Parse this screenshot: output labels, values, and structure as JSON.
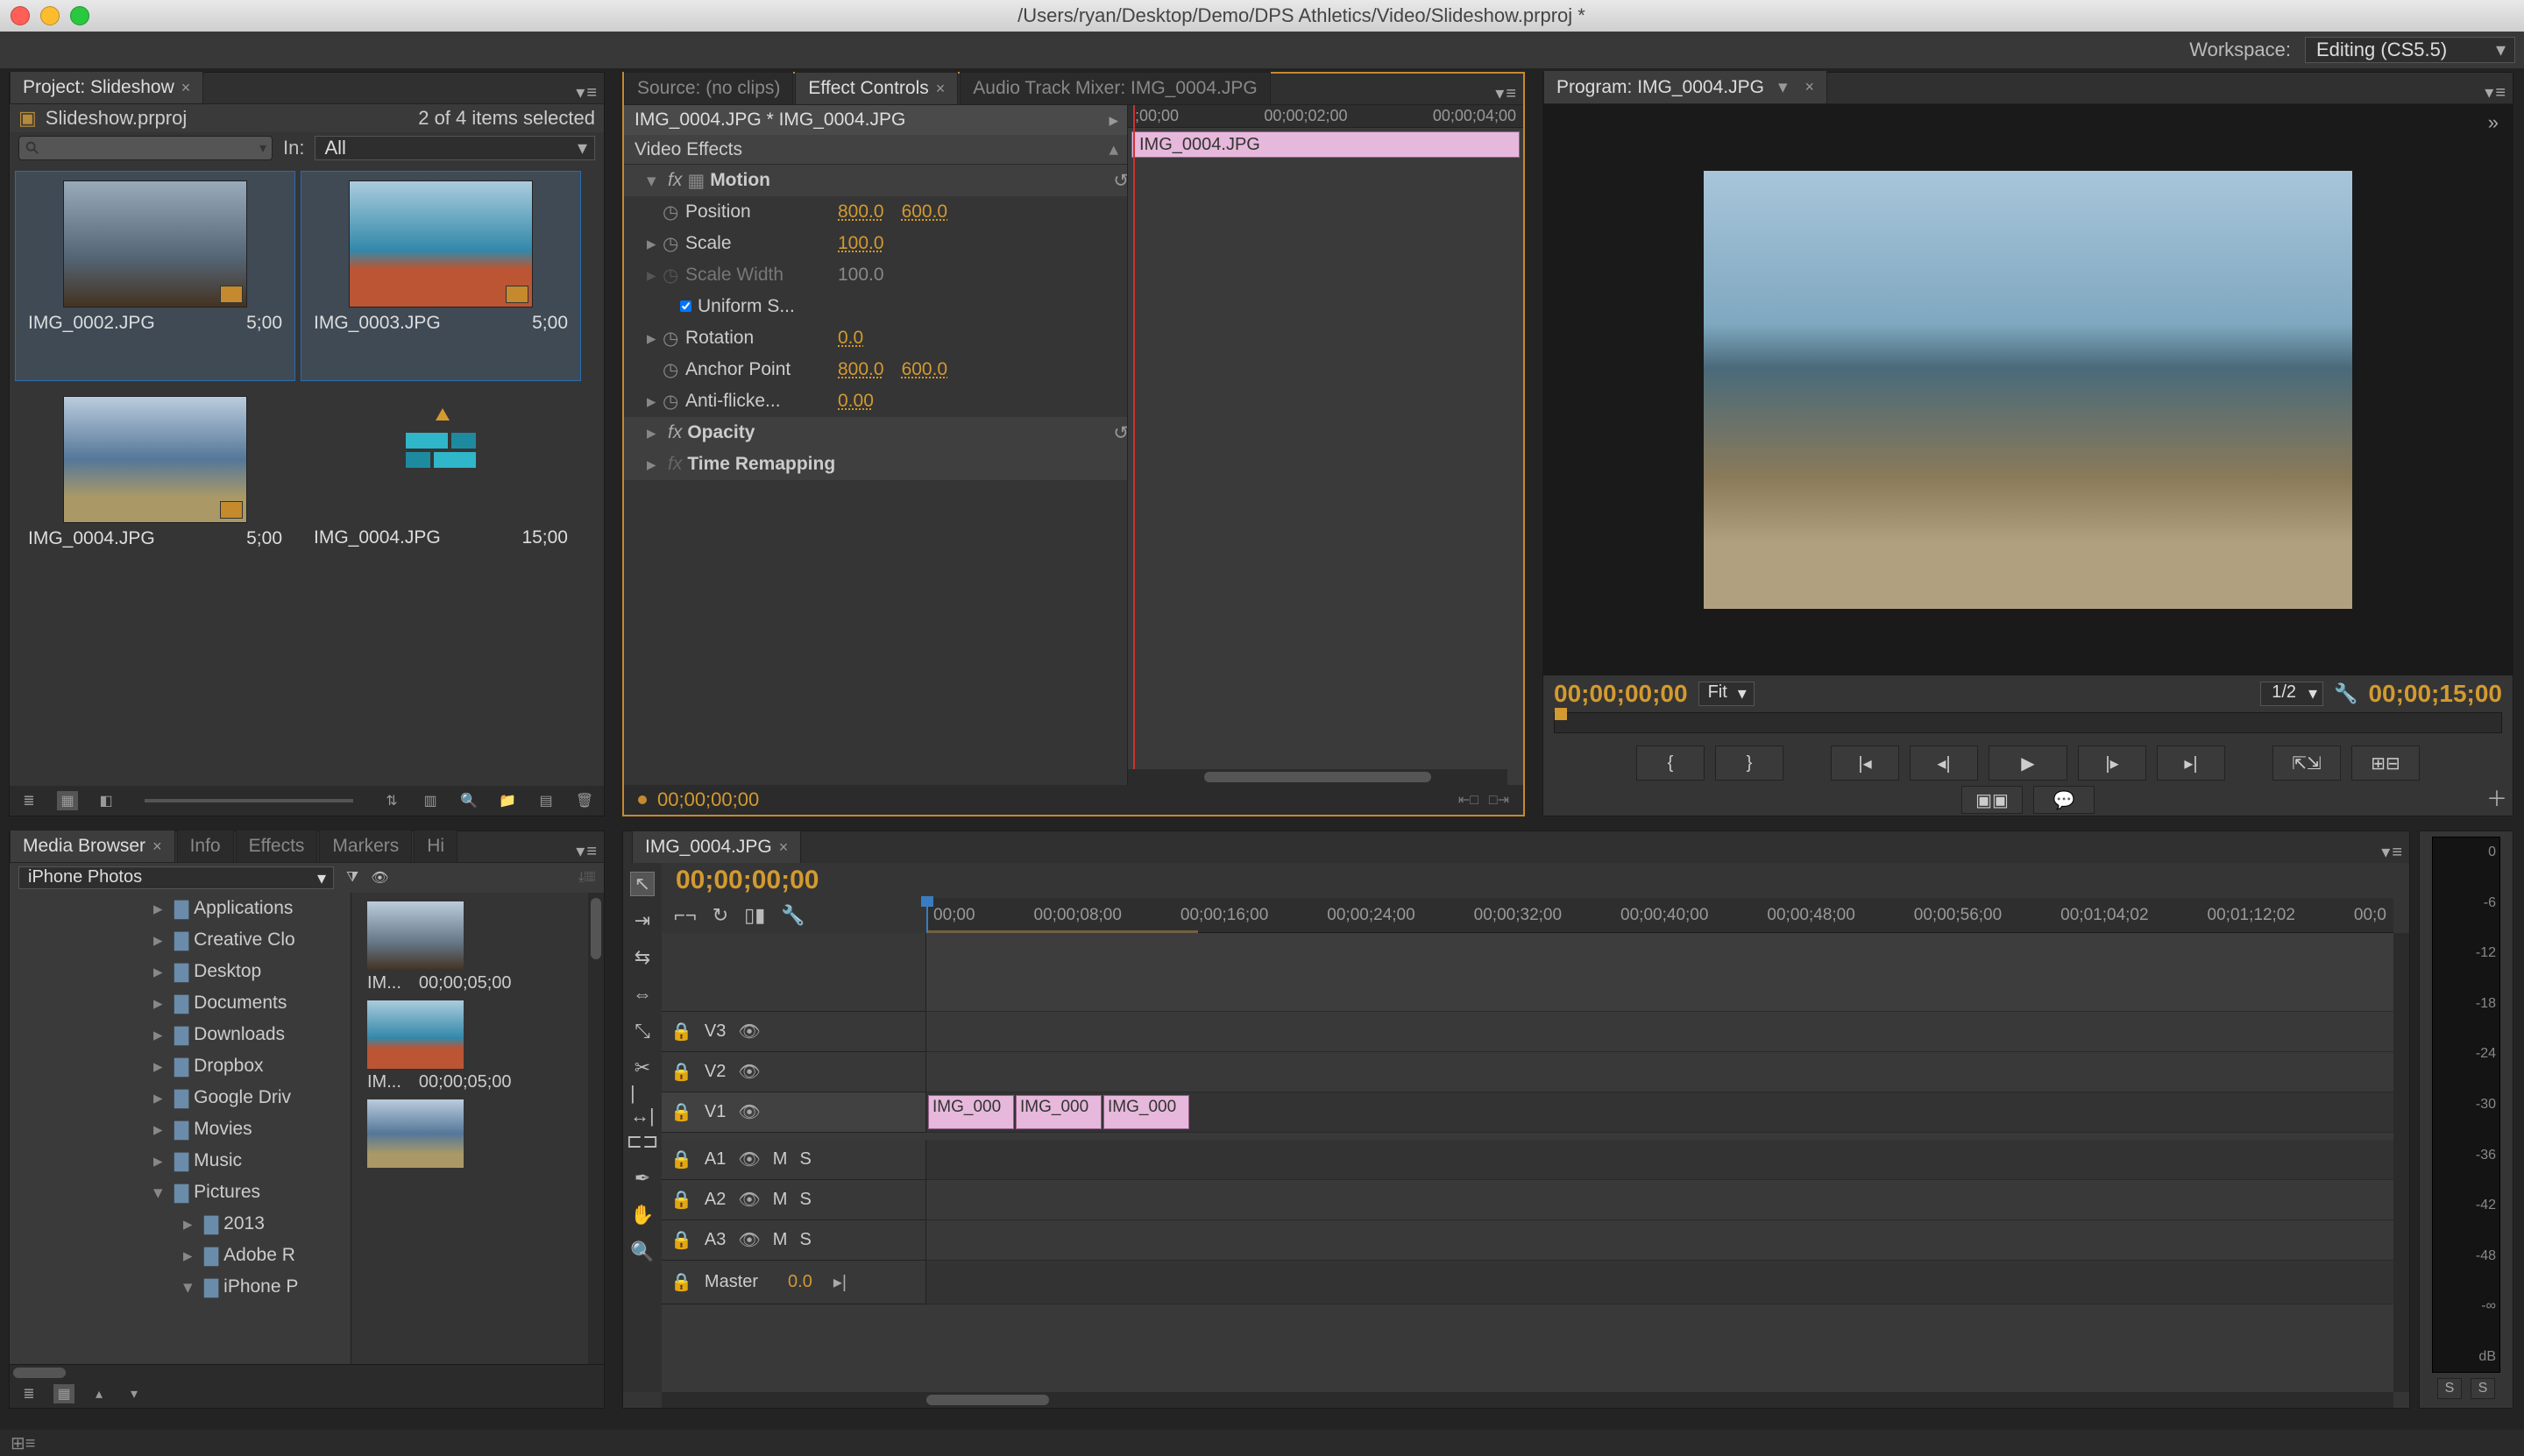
{
  "window": {
    "title_path": "/Users/ryan/Desktop/Demo/DPS Athletics/Video/Slideshow.prproj *"
  },
  "workspace": {
    "label": "Workspace:",
    "value": "Editing (CS5.5)"
  },
  "project": {
    "tab": "Project: Slideshow",
    "file": "Slideshow.prproj",
    "selection": "2 of 4 items selected",
    "in_label": "In:",
    "filter": "All",
    "items": [
      {
        "name": "IMG_0002.JPG",
        "dur": "5;00",
        "selected": true
      },
      {
        "name": "IMG_0003.JPG",
        "dur": "5;00",
        "selected": true
      },
      {
        "name": "IMG_0004.JPG",
        "dur": "5;00",
        "selected": false
      },
      {
        "name": "IMG_0004.JPG",
        "dur": "15;00",
        "selected": false,
        "is_sequence": true
      }
    ]
  },
  "source_tabs": {
    "source": "Source: (no clips)",
    "ec": "Effect Controls",
    "mixer": "Audio Track Mixer: IMG_0004.JPG"
  },
  "effect_controls": {
    "clip_header": "IMG_0004.JPG * IMG_0004.JPG",
    "lane_clip": "IMG_0004.JPG",
    "ruler": [
      ";00;00",
      "00;00;02;00",
      "00;00;04;00"
    ],
    "section": "Video Effects",
    "motion": {
      "label": "Motion",
      "position": {
        "label": "Position",
        "x": "800.0",
        "y": "600.0"
      },
      "scale": {
        "label": "Scale",
        "v": "100.0"
      },
      "scale_w": {
        "label": "Scale Width",
        "v": "100.0"
      },
      "uniform": "Uniform S...",
      "rotation": {
        "label": "Rotation",
        "v": "0.0"
      },
      "anchor": {
        "label": "Anchor Point",
        "x": "800.0",
        "y": "600.0"
      },
      "antiflicker": {
        "label": "Anti-flicke...",
        "v": "0.00"
      }
    },
    "opacity": "Opacity",
    "time_remap": "Time Remapping",
    "timecode": "00;00;00;00"
  },
  "program": {
    "tab": "Program: IMG_0004.JPG",
    "tc_left": "00;00;00;00",
    "fit": "Fit",
    "half": "1/2",
    "tc_right": "00;00;15;00"
  },
  "media_browser": {
    "tabs": [
      "Media Browser",
      "Info",
      "Effects",
      "Markers",
      "Hi"
    ],
    "dropdown": "iPhone Photos",
    "tree": [
      {
        "indent": 1,
        "tw": "▸",
        "label": "Applications"
      },
      {
        "indent": 1,
        "tw": "▸",
        "label": "Creative Clo"
      },
      {
        "indent": 1,
        "tw": "▸",
        "label": "Desktop"
      },
      {
        "indent": 1,
        "tw": "▸",
        "label": "Documents"
      },
      {
        "indent": 1,
        "tw": "▸",
        "label": "Downloads"
      },
      {
        "indent": 1,
        "tw": "▸",
        "label": "Dropbox"
      },
      {
        "indent": 1,
        "tw": "▸",
        "label": "Google Driv"
      },
      {
        "indent": 1,
        "tw": "▸",
        "label": "Movies"
      },
      {
        "indent": 1,
        "tw": "▸",
        "label": "Music"
      },
      {
        "indent": 1,
        "tw": "▾",
        "label": "Pictures"
      },
      {
        "indent": 2,
        "tw": "▸",
        "label": "2013"
      },
      {
        "indent": 2,
        "tw": "▸",
        "label": "Adobe R"
      },
      {
        "indent": 2,
        "tw": "▾",
        "label": "iPhone P"
      }
    ],
    "thumbs": [
      {
        "name": "IM...",
        "dur": "00;00;05;00"
      },
      {
        "name": "IM...",
        "dur": "00;00;05;00"
      },
      {
        "name": "",
        "dur": ""
      }
    ]
  },
  "timeline": {
    "tab": "IMG_0004.JPG",
    "tc": "00;00;00;00",
    "ruler": [
      "00;00",
      "00;00;08;00",
      "00;00;16;00",
      "00;00;24;00",
      "00;00;32;00",
      "00;00;40;00",
      "00;00;48;00",
      "00;00;56;00",
      "00;01;04;02",
      "00;01;12;02",
      "00;0"
    ],
    "v_tracks": [
      "V3",
      "V2",
      "V1"
    ],
    "a_tracks": [
      "A1",
      "A2",
      "A3"
    ],
    "master": "Master",
    "master_val": "0.0",
    "ms": {
      "m": "M",
      "s": "S"
    },
    "clips": [
      "IMG_000",
      "IMG_000",
      "IMG_000"
    ]
  },
  "meter": {
    "scale": [
      "0",
      "-6",
      "-12",
      "-18",
      "-24",
      "-30",
      "-36",
      "-42",
      "-48",
      "-∞",
      "dB"
    ],
    "solo": "S"
  }
}
